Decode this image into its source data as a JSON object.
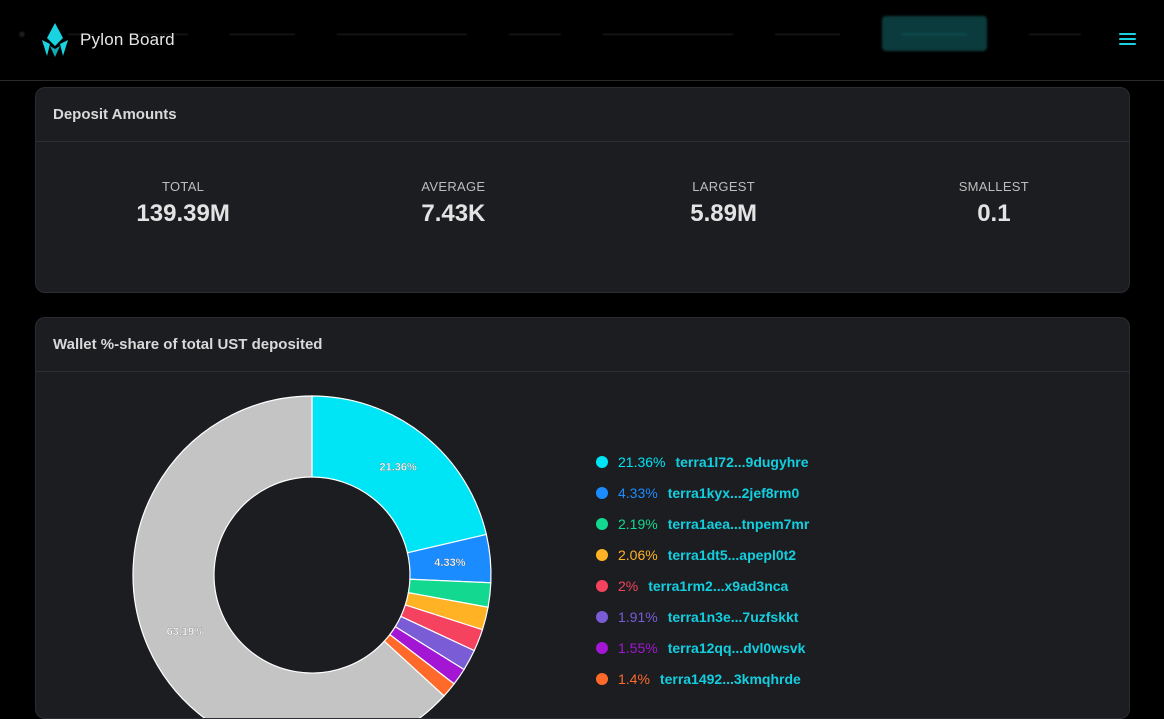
{
  "header": {
    "brand": "Pylon Board"
  },
  "deposit_amounts": {
    "title": "Deposit Amounts",
    "stats": [
      {
        "label": "TOTAL",
        "value": "139.39M"
      },
      {
        "label": "AVERAGE",
        "value": "7.43K"
      },
      {
        "label": "LARGEST",
        "value": "5.89M"
      },
      {
        "label": "SMALLEST",
        "value": "0.1"
      }
    ]
  },
  "wallet_share": {
    "title": "Wallet %-share of total UST deposited"
  },
  "chart_data": {
    "type": "pie",
    "title": "Wallet %-share of total UST deposited",
    "slices": [
      {
        "label": "terra1l72...9dugyhre",
        "value": 21.36,
        "pct_label": "21.36%",
        "color": "#00e5f5"
      },
      {
        "label": "terra1kyx...2jef8rm0",
        "value": 4.33,
        "pct_label": "4.33%",
        "color": "#1a8cff"
      },
      {
        "label": "terra1aea...tnpem7mr",
        "value": 2.19,
        "pct_label": "2.19%",
        "color": "#12d98f"
      },
      {
        "label": "terra1dt5...apepl0t2",
        "value": 2.06,
        "pct_label": "2.06%",
        "color": "#ffb224"
      },
      {
        "label": "terra1rm2...x9ad3nca",
        "value": 2.0,
        "pct_label": "2%",
        "color": "#f5435f"
      },
      {
        "label": "terra1n3e...7uzfskkt",
        "value": 1.91,
        "pct_label": "1.91%",
        "color": "#7a5cd6"
      },
      {
        "label": "terra12qq...dvl0wsvk",
        "value": 1.55,
        "pct_label": "1.55%",
        "color": "#a316d4"
      },
      {
        "label": "terra1492...3kmqhrde",
        "value": 1.4,
        "pct_label": "1.4%",
        "color": "#ff6a2b"
      },
      {
        "label": "",
        "value": 63.19,
        "pct_label": "63.19%",
        "color": "#c4c4c4"
      }
    ],
    "legend_position": "right"
  }
}
